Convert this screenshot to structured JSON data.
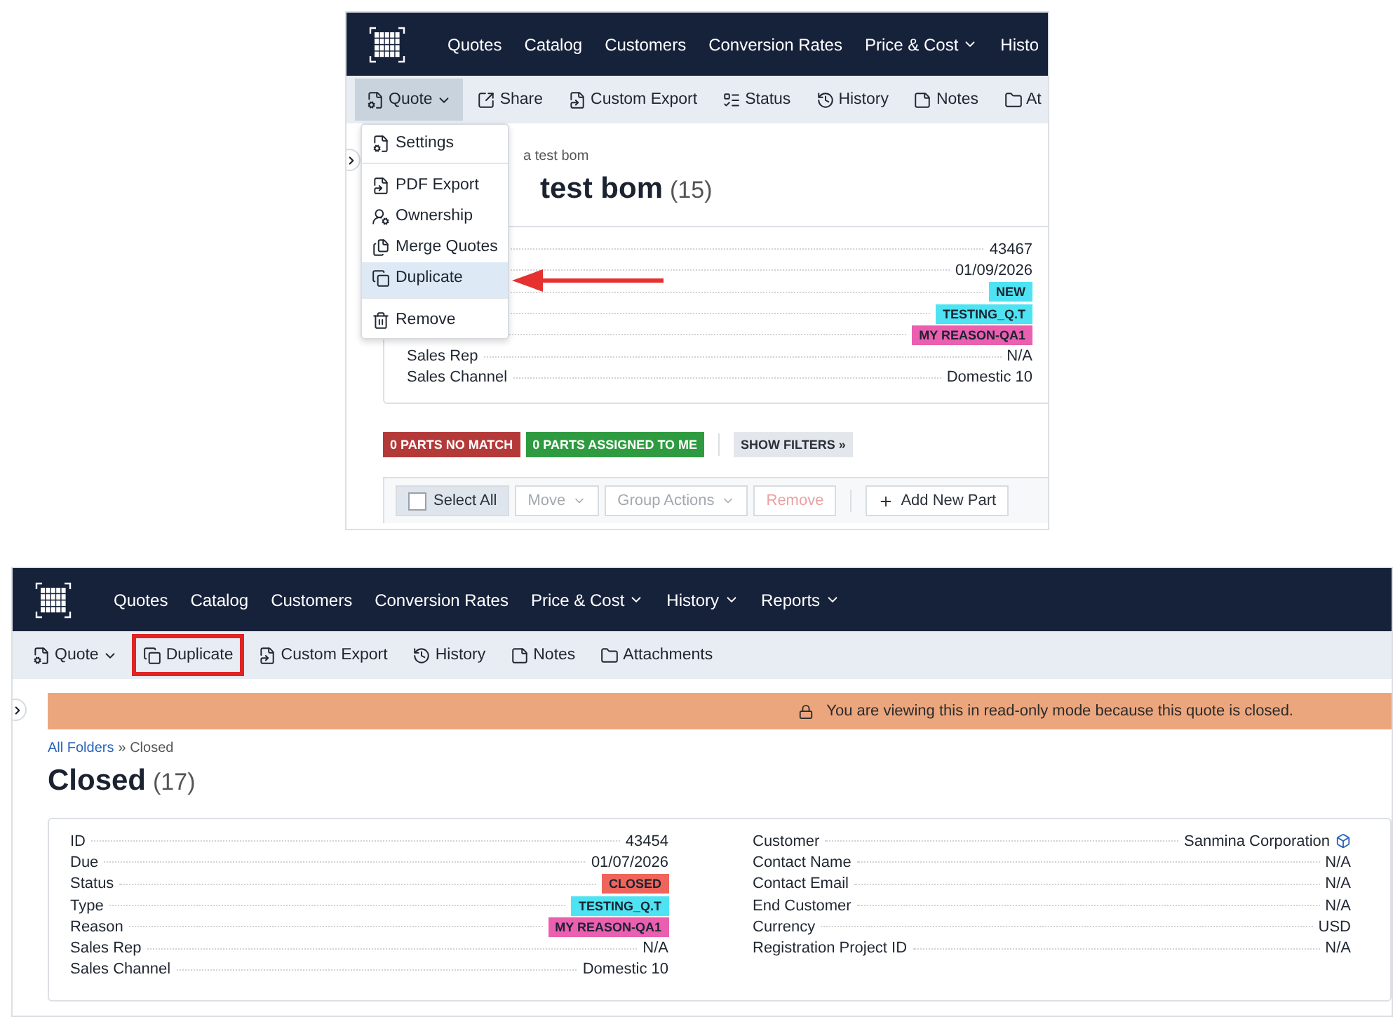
{
  "screenshots": [
    {
      "nav": {
        "items": [
          {
            "label": "Quotes",
            "dropdown": false
          },
          {
            "label": "Catalog",
            "dropdown": false
          },
          {
            "label": "Customers",
            "dropdown": false
          },
          {
            "label": "Conversion Rates",
            "dropdown": false
          },
          {
            "label": "Price & Cost",
            "dropdown": true
          },
          {
            "label": "Histo",
            "dropdown": false
          }
        ]
      },
      "toolbar": [
        {
          "kind": "quote",
          "label": "Quote",
          "dropdown": true,
          "selected": true,
          "outlined": false
        },
        {
          "kind": "share",
          "label": "Share",
          "dropdown": false,
          "selected": false,
          "outlined": false
        },
        {
          "kind": "export",
          "label": "Custom Export",
          "dropdown": false,
          "selected": false,
          "outlined": false
        },
        {
          "kind": "status",
          "label": "Status",
          "dropdown": false,
          "selected": false,
          "outlined": false
        },
        {
          "kind": "history",
          "label": "History",
          "dropdown": false,
          "selected": false,
          "outlined": false
        },
        {
          "kind": "notes",
          "label": "Notes",
          "dropdown": false,
          "selected": false,
          "outlined": false
        },
        {
          "kind": "attachments",
          "label": "At",
          "dropdown": false,
          "selected": false,
          "outlined": false
        }
      ],
      "menu": [
        {
          "kind": "settings",
          "label": "Settings",
          "selected": false,
          "divider_after": true
        },
        {
          "kind": "pdf",
          "label": "PDF Export",
          "selected": false,
          "divider_after": false
        },
        {
          "kind": "ownership",
          "label": "Ownership",
          "selected": false,
          "divider_after": false
        },
        {
          "kind": "merge",
          "label": "Merge Quotes",
          "selected": false,
          "divider_after": false
        },
        {
          "kind": "duplicate",
          "label": "Duplicate",
          "selected": true,
          "divider_after": true
        },
        {
          "kind": "remove",
          "label": "Remove",
          "selected": false,
          "divider_after": false
        }
      ],
      "breadcrumb": {
        "text": "a test bom"
      },
      "title": {
        "text": "test bom",
        "count": "(15)"
      },
      "details": [
        [
          {
            "kind": "text",
            "value": "43467"
          },
          {
            "kind": "text",
            "value": "01/09/2026"
          },
          {
            "kind": "tag",
            "value": "NEW",
            "color": "#4ee3f2"
          },
          {
            "kind": "tag",
            "value": "TESTING_Q.T",
            "color": "#4ee3f2"
          },
          {
            "kind": "tag",
            "value": "MY REASON-QA1",
            "color": "#ea5fb0"
          },
          {
            "kind": "text",
            "label": "Sales Rep",
            "value": "N/A"
          },
          {
            "kind": "text",
            "label": "Sales Channel",
            "value": "Domestic 10"
          }
        ]
      ],
      "filters": [
        {
          "label": "0 PARTS NO MATCH",
          "color": "#b43a3a"
        },
        {
          "label": "0 PARTS ASSIGNED TO ME",
          "color": "#2f9b40"
        },
        {
          "label": "SHOW FILTERS »",
          "color": "#e3e7ec"
        }
      ],
      "actions": [
        {
          "kind": "select",
          "label": "Select All",
          "disabled": false,
          "checked": false
        },
        {
          "kind": "dropdown",
          "label": "Move",
          "disabled": true
        },
        {
          "kind": "dropdown",
          "label": "Group Actions",
          "disabled": true
        },
        {
          "kind": "danger",
          "label": "Remove",
          "disabled": true
        },
        {
          "kind": "add",
          "label": "Add New Part",
          "disabled": false
        }
      ],
      "annotation": {
        "kind": "arrow"
      }
    },
    {
      "nav": {
        "items": [
          {
            "label": "Quotes",
            "dropdown": false
          },
          {
            "label": "Catalog",
            "dropdown": false
          },
          {
            "label": "Customers",
            "dropdown": false
          },
          {
            "label": "Conversion Rates",
            "dropdown": false
          },
          {
            "label": "Price & Cost",
            "dropdown": true
          },
          {
            "label": "History",
            "dropdown": true
          },
          {
            "label": "Reports",
            "dropdown": true
          }
        ]
      },
      "toolbar": [
        {
          "kind": "quote",
          "label": "Quote",
          "dropdown": true,
          "selected": false,
          "outlined": false
        },
        {
          "kind": "duplicate",
          "label": "Duplicate",
          "dropdown": false,
          "selected": false,
          "outlined": true
        },
        {
          "kind": "export",
          "label": "Custom Export",
          "dropdown": false,
          "selected": false,
          "outlined": false
        },
        {
          "kind": "history",
          "label": "History",
          "dropdown": false,
          "selected": false,
          "outlined": false
        },
        {
          "kind": "notes",
          "label": "Notes",
          "dropdown": false,
          "selected": false,
          "outlined": false
        },
        {
          "kind": "attachments",
          "label": "Attachments",
          "dropdown": false,
          "selected": false,
          "outlined": false
        }
      ],
      "banner": {
        "text": "You are viewing this in read-only mode because this quote is closed."
      },
      "breadcrumb": {
        "link": "All Folders",
        "text": "» Closed"
      },
      "title": {
        "text": "Closed",
        "count": "(17)"
      },
      "details": [
        [
          {
            "kind": "text",
            "label": "ID",
            "value": "43454"
          },
          {
            "kind": "text",
            "label": "Due",
            "value": "01/07/2026"
          },
          {
            "kind": "tag",
            "label": "Status",
            "value": "CLOSED",
            "color": "#f0655b"
          },
          {
            "kind": "tag",
            "label": "Type",
            "value": "TESTING_Q.T",
            "color": "#4ee3f2"
          },
          {
            "kind": "tag",
            "label": "Reason",
            "value": "MY REASON-QA1",
            "color": "#ea5fb0"
          },
          {
            "kind": "text",
            "label": "Sales Rep",
            "value": "N/A"
          },
          {
            "kind": "text",
            "label": "Sales Channel",
            "value": "Domestic 10"
          }
        ],
        [
          {
            "kind": "entity",
            "label": "Customer",
            "value": "Sanmina Corporation"
          },
          {
            "kind": "text",
            "label": "Contact Name",
            "value": "N/A"
          },
          {
            "kind": "text",
            "label": "Contact Email",
            "value": "N/A"
          },
          {
            "kind": "text",
            "label": "End Customer",
            "value": "N/A"
          },
          {
            "kind": "text",
            "label": "Currency",
            "value": "USD"
          },
          {
            "kind": "text",
            "label": "Registration Project ID",
            "value": "N/A"
          }
        ]
      ]
    }
  ]
}
